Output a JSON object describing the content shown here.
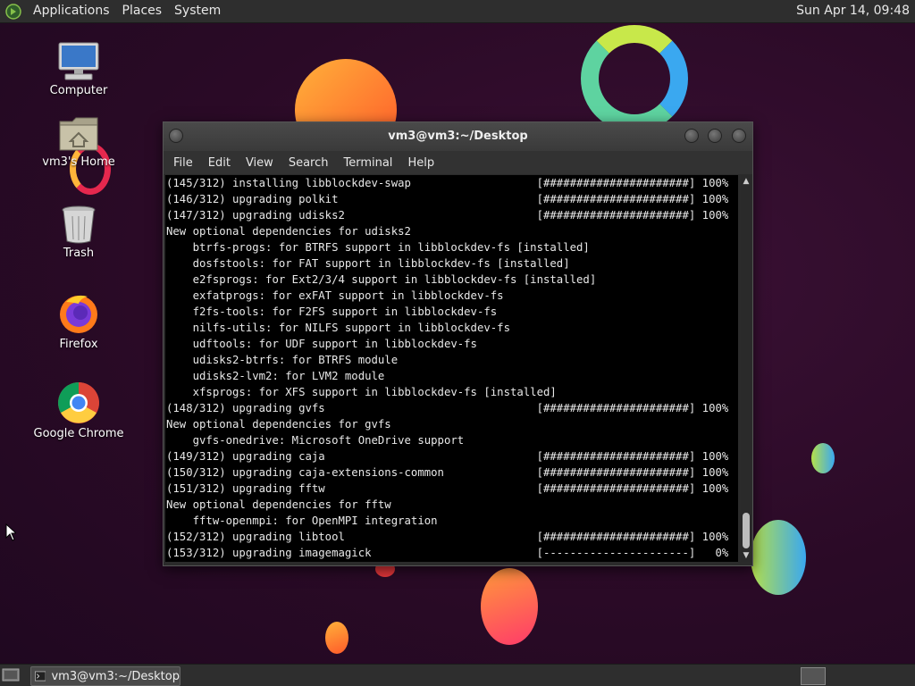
{
  "top_panel": {
    "menus": [
      "Applications",
      "Places",
      "System"
    ],
    "clock": "Sun Apr 14, 09:48"
  },
  "desktop_icons": [
    {
      "label": "Computer",
      "icon": "computer-icon"
    },
    {
      "label": "vm3's Home",
      "icon": "home-folder-icon"
    },
    {
      "label": "Trash",
      "icon": "trash-icon"
    },
    {
      "label": "Firefox",
      "icon": "firefox-icon"
    },
    {
      "label": "Google Chrome",
      "icon": "chrome-icon"
    }
  ],
  "terminal_window": {
    "title": "vm3@vm3:~/Desktop",
    "menus": [
      "File",
      "Edit",
      "View",
      "Search",
      "Terminal",
      "Help"
    ],
    "lines": [
      "(145/312) installing libblockdev-swap                   [######################] 100%",
      "(146/312) upgrading polkit                              [######################] 100%",
      "(147/312) upgrading udisks2                             [######################] 100%",
      "New optional dependencies for udisks2",
      "    btrfs-progs: for BTRFS support in libblockdev-fs [installed]",
      "    dosfstools: for FAT support in libblockdev-fs [installed]",
      "    e2fsprogs: for Ext2/3/4 support in libblockdev-fs [installed]",
      "    exfatprogs: for exFAT support in libblockdev-fs",
      "    f2fs-tools: for F2FS support in libblockdev-fs",
      "    nilfs-utils: for NILFS support in libblockdev-fs",
      "    udftools: for UDF support in libblockdev-fs",
      "    udisks2-btrfs: for BTRFS module",
      "    udisks2-lvm2: for LVM2 module",
      "    xfsprogs: for XFS support in libblockdev-fs [installed]",
      "(148/312) upgrading gvfs                                [######################] 100%",
      "New optional dependencies for gvfs",
      "    gvfs-onedrive: Microsoft OneDrive support",
      "(149/312) upgrading caja                                [######################] 100%",
      "(150/312) upgrading caja-extensions-common              [######################] 100%",
      "(151/312) upgrading fftw                                [######################] 100%",
      "New optional dependencies for fftw",
      "    fftw-openmpi: for OpenMPI integration",
      "(152/312) upgrading libtool                             [######################] 100%",
      "(153/312) upgrading imagemagick                         [----------------------]   0%"
    ]
  },
  "taskbar": {
    "task_label": "vm3@vm3:~/Desktop"
  }
}
